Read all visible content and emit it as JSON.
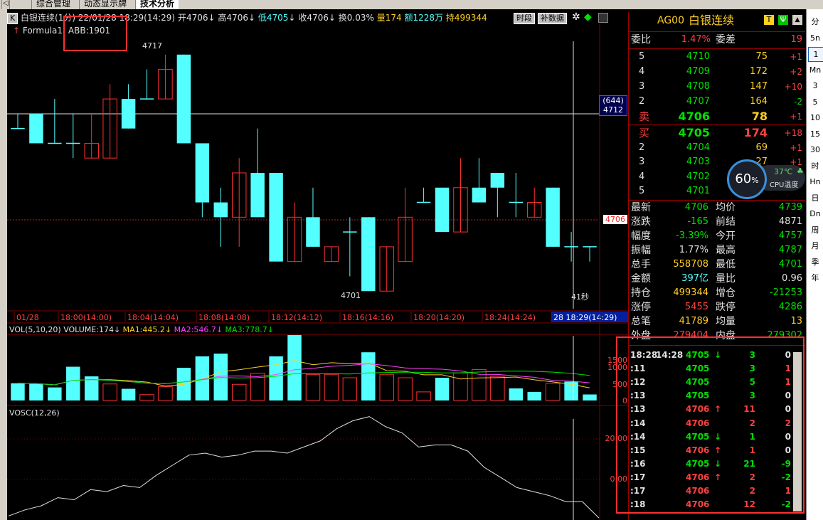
{
  "tabs": {
    "left_arrow": "◁",
    "items": [
      "综合管理",
      "动态显示牌",
      "技术分析"
    ],
    "active_index": 2
  },
  "header": {
    "k_label": "K",
    "title": "白银连续(1分)",
    "datetime": "22/01/28  18:29(14:29)",
    "open_label": "开",
    "open": "4706",
    "high_label": "高",
    "high": "4706",
    "low_label": "低",
    "low": "4705",
    "close_label": "收",
    "close": "4706",
    "turnover_label": "换",
    "turnover": "0.03%",
    "volume_label": "量",
    "volume": "174",
    "amount_label": "额",
    "amount": "1228万",
    "oi_label": "持",
    "oi": "499344",
    "btn_period": "时段",
    "btn_fill": "补数据"
  },
  "formula": {
    "label": "Formula1:",
    "abb": "ABB:1901"
  },
  "price_chart": {
    "labels": {
      "high_marker": "4717",
      "low_marker": "4701",
      "cursor_count": "(644)",
      "cursor_price": "4712",
      "last_price": "4706",
      "seconds": "41秒"
    },
    "candles": [
      {
        "o": 4712,
        "c": 4712,
        "h": 4713,
        "l": 4712
      },
      {
        "o": 4713,
        "c": 4711,
        "h": 4713,
        "l": 4711
      },
      {
        "o": 4711,
        "c": 4711,
        "h": 4714,
        "l": 4711
      },
      {
        "o": 4711,
        "c": 4711,
        "h": 4713,
        "l": 4710
      },
      {
        "o": 4710,
        "c": 4711,
        "h": 4713,
        "l": 4710
      },
      {
        "o": 4710,
        "c": 4714,
        "h": 4715,
        "l": 4710
      },
      {
        "o": 4714,
        "c": 4712,
        "h": 4715,
        "l": 4712
      },
      {
        "o": 4714,
        "c": 4714,
        "h": 4716,
        "l": 4714
      },
      {
        "o": 4714,
        "c": 4716,
        "h": 4717,
        "l": 4714
      },
      {
        "o": 4717,
        "c": 4711,
        "h": 4717,
        "l": 4711
      },
      {
        "o": 4711,
        "c": 4707,
        "h": 4711,
        "l": 4706
      },
      {
        "o": 4707,
        "c": 4706,
        "h": 4708,
        "l": 4704
      },
      {
        "o": 4706,
        "c": 4709,
        "h": 4710,
        "l": 4704
      },
      {
        "o": 4709,
        "c": 4706,
        "h": 4712,
        "l": 4706
      },
      {
        "o": 4709,
        "c": 4703,
        "h": 4709,
        "l": 4703
      },
      {
        "o": 4703,
        "c": 4706,
        "h": 4707,
        "l": 4703
      },
      {
        "o": 4706,
        "c": 4704,
        "h": 4708,
        "l": 4704
      },
      {
        "o": 4703,
        "c": 4704,
        "h": 4704,
        "l": 4703
      },
      {
        "o": 4705,
        "c": 4705,
        "h": 4706,
        "l": 4702
      },
      {
        "o": 4706,
        "c": 4701,
        "h": 4706,
        "l": 4701
      },
      {
        "o": 4701,
        "c": 4704,
        "h": 4704,
        "l": 4701
      },
      {
        "o": 4703,
        "c": 4706,
        "h": 4708,
        "l": 4703
      },
      {
        "o": 4707,
        "c": 4707,
        "h": 4708,
        "l": 4707
      },
      {
        "o": 4708,
        "c": 4705,
        "h": 4708,
        "l": 4705
      },
      {
        "o": 4705,
        "c": 4708,
        "h": 4710,
        "l": 4705
      },
      {
        "o": 4708,
        "c": 4707,
        "h": 4710,
        "l": 4707
      },
      {
        "o": 4709,
        "c": 4708,
        "h": 4709,
        "l": 4706
      },
      {
        "o": 4707,
        "c": 4707,
        "h": 4709,
        "l": 4706
      },
      {
        "o": 4706,
        "c": 4707,
        "h": 4708,
        "l": 4706
      },
      {
        "o": 4708,
        "c": 4704,
        "h": 4708,
        "l": 4704
      },
      {
        "o": 4704,
        "c": 4704,
        "h": 4705,
        "l": 4703
      },
      {
        "o": 4704,
        "c": 4704,
        "h": 4704,
        "l": 4703
      }
    ]
  },
  "time_axis": [
    "01/28",
    "18:00(14:00)",
    "18:04(14:04)",
    "18:08(14:08)",
    "18:12(14:12)",
    "18:16(14:16)",
    "18:20(14:20)",
    "18:24(14:24)",
    "28  18:29(14:29)"
  ],
  "volume_panel": {
    "title": "VOL(5,10,20)",
    "vol_label": "VOLUME:174↓",
    "ma1": "MA1:445.2↓",
    "ma2": "MA2:546.7↓",
    "ma3": "MA3:778.7↓",
    "axis": [
      "1500",
      "1000",
      "500",
      "0"
    ],
    "values": [
      500,
      480,
      380,
      980,
      700,
      480,
      340,
      170,
      400,
      950,
      1280,
      1360,
      470,
      790,
      1280,
      1900,
      750,
      760,
      660,
      1400,
      760,
      660,
      250,
      660,
      800,
      900,
      700,
      350,
      250,
      500,
      550,
      175
    ],
    "ups": [
      false,
      false,
      false,
      false,
      false,
      true,
      false,
      true,
      true,
      false,
      false,
      false,
      true,
      true,
      false,
      false,
      true,
      true,
      true,
      false,
      true,
      true,
      true,
      false,
      true,
      true,
      true,
      false,
      false,
      true,
      false,
      false
    ]
  },
  "vosc_panel": {
    "title": "VOSC(12,26)",
    "axis": [
      "20.00",
      "0.00"
    ],
    "values": [
      -18,
      -15,
      -13,
      -9,
      -10,
      -5,
      -6,
      -3,
      -4,
      2,
      7,
      12,
      13,
      11,
      12,
      14,
      14,
      13,
      16,
      19,
      25,
      29,
      31,
      26,
      23,
      16,
      17,
      17,
      14,
      6,
      1,
      -4,
      -6,
      -8,
      -11,
      -11,
      -19
    ]
  },
  "quote": {
    "code": "AG00",
    "name": "白银连续",
    "wei_bi_label": "委比",
    "wei_bi": "1.47%",
    "wei_cha_label": "委差",
    "wei_cha": "19",
    "asks": [
      {
        "level": "5",
        "price": "4710",
        "vol": "75",
        "chg": "+1"
      },
      {
        "level": "4",
        "price": "4709",
        "vol": "172",
        "chg": "+2"
      },
      {
        "level": "3",
        "price": "4708",
        "vol": "147",
        "chg": "+10"
      },
      {
        "level": "2",
        "price": "4707",
        "vol": "164",
        "chg": "-2"
      },
      {
        "level": "卖",
        "price": "4706",
        "vol": "78",
        "chg": "+1"
      }
    ],
    "bids": [
      {
        "level": "买",
        "price": "4705",
        "vol": "174",
        "chg": "+18"
      },
      {
        "level": "2",
        "price": "4704",
        "vol": "69",
        "chg": "+1"
      },
      {
        "level": "3",
        "price": "4703",
        "vol": "27",
        "chg": "+1"
      },
      {
        "level": "4",
        "price": "4702",
        "vol": "",
        "chg": ""
      },
      {
        "level": "5",
        "price": "4701",
        "vol": "",
        "chg": ""
      }
    ],
    "stats": [
      {
        "l1": "最新",
        "v1": "4706",
        "l2": "均价",
        "v2": "4739"
      },
      {
        "l1": "涨跌",
        "v1": "-165",
        "l2": "前结",
        "v2": "4871"
      },
      {
        "l1": "幅度",
        "v1": "-3.39%",
        "l2": "今开",
        "v2": "4757"
      },
      {
        "l1": "振幅",
        "v1": "1.77%",
        "l2": "最高",
        "v2": "4787"
      },
      {
        "l1": "总手",
        "v1": "558708",
        "l2": "最低",
        "v2": "4701"
      },
      {
        "l1": "金额",
        "v1": "397亿",
        "l2": "量比",
        "v2": "0.96"
      },
      {
        "l1": "持仓",
        "v1": "499344",
        "l2": "增仓",
        "v2": "-21253"
      },
      {
        "l1": "涨停",
        "v1": "5455",
        "l2": "跌停",
        "v2": "4286"
      },
      {
        "l1": "总笔",
        "v1": "41789",
        "l2": "均量",
        "v2": "13"
      },
      {
        "l1": "外盘",
        "v1": "279404",
        "l2": "内盘",
        "v2": "279302"
      }
    ],
    "ticks": [
      {
        "time": "18:28",
        "time2": "14:28",
        "price": "4705",
        "dir": "↓",
        "vol": "3",
        "oi": "0"
      },
      {
        "time": ":11",
        "time2": "",
        "price": "4705",
        "dir": "",
        "vol": "3",
        "oi": "1"
      },
      {
        "time": ":12",
        "time2": "",
        "price": "4705",
        "dir": "",
        "vol": "5",
        "oi": "1"
      },
      {
        "time": ":13",
        "time2": "",
        "price": "4705",
        "dir": "",
        "vol": "3",
        "oi": "0"
      },
      {
        "time": ":13",
        "time2": "",
        "price": "4706",
        "dir": "↑",
        "vol": "11",
        "oi": "0"
      },
      {
        "time": ":14",
        "time2": "",
        "price": "4706",
        "dir": "",
        "vol": "2",
        "oi": "2"
      },
      {
        "time": ":14",
        "time2": "",
        "price": "4705",
        "dir": "↓",
        "vol": "1",
        "oi": "0"
      },
      {
        "time": ":15",
        "time2": "",
        "price": "4706",
        "dir": "↑",
        "vol": "1",
        "oi": "0"
      },
      {
        "time": ":16",
        "time2": "",
        "price": "4705",
        "dir": "↓",
        "vol": "21",
        "oi": "-9"
      },
      {
        "time": ":17",
        "time2": "",
        "price": "4706",
        "dir": "↑",
        "vol": "2",
        "oi": "-2"
      },
      {
        "time": ":17",
        "time2": "",
        "price": "4706",
        "dir": "",
        "vol": "2",
        "oi": "1"
      },
      {
        "time": ":18",
        "time2": "",
        "price": "4706",
        "dir": "",
        "vol": "12",
        "oi": "-2"
      }
    ],
    "btn_t": "T",
    "btn_ps": "Ψ",
    "btn_arrow": "▲"
  },
  "cpu": {
    "percent": "60",
    "unit": "%",
    "temp": "37℃",
    "label": "CPU温度"
  },
  "side_periods": [
    "分",
    "5n",
    "1",
    "Mn",
    "3",
    "5",
    "10",
    "15",
    "30",
    "时",
    "Hn",
    "日",
    "Dn",
    "周",
    "月",
    "季",
    "年"
  ],
  "colors": {
    "up": "#ff3030",
    "down": "#54ffff",
    "grid": "#800000"
  }
}
